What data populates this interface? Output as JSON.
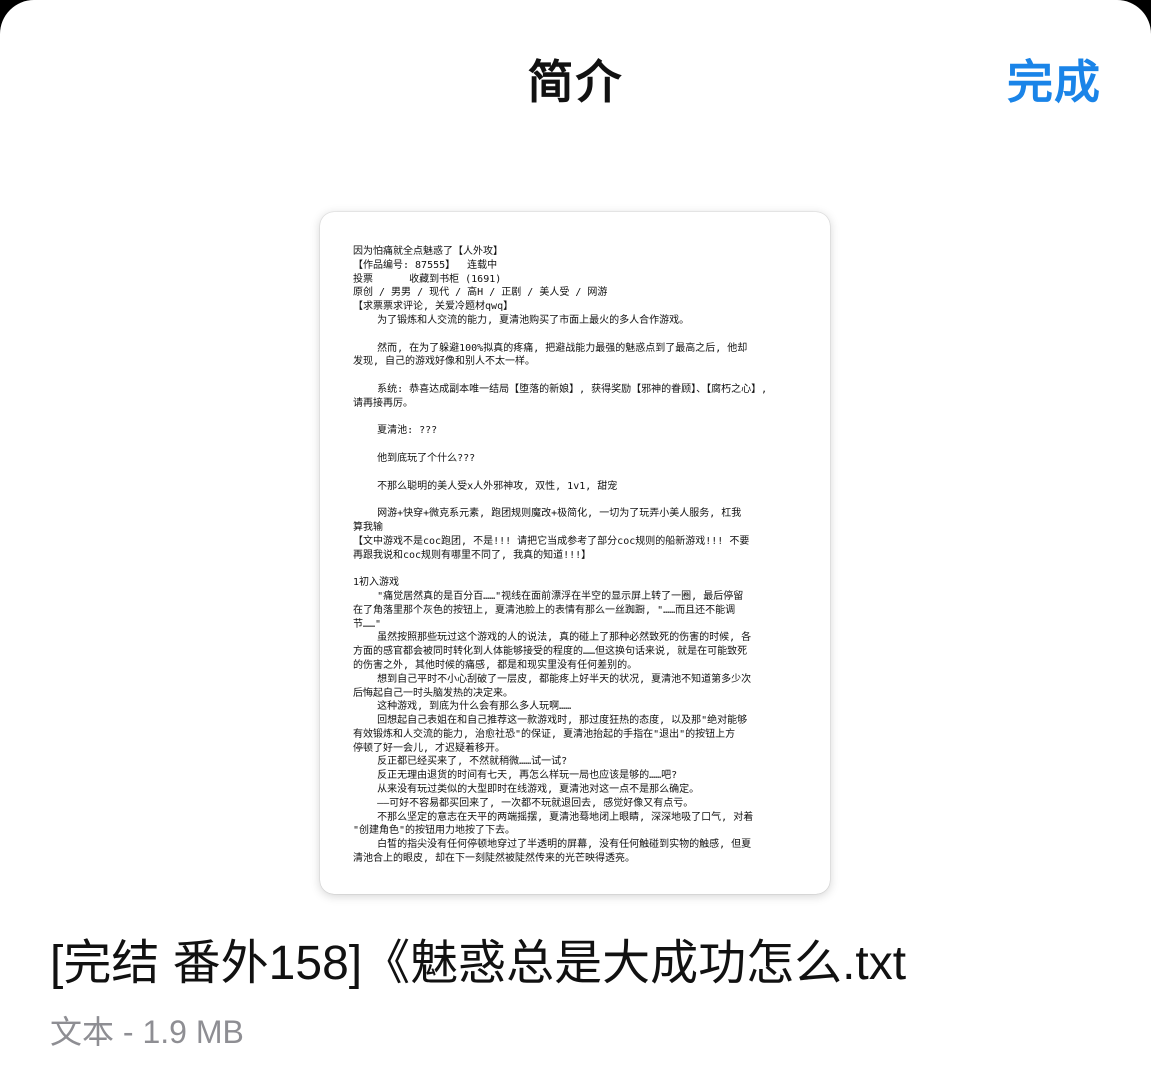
{
  "header": {
    "title": "简介",
    "done_label": "完成"
  },
  "document": {
    "lines": [
      "因为怕痛就全点魅惑了【人外攻】",
      "【作品编号: 87555】  连载中",
      "投票      收藏到书柜 (1691)",
      "原创 / 男男 / 现代 / 高H / 正剧 / 美人受 / 网游",
      "【求票票求评论, 关爱冷题材qwq】",
      "    为了锻炼和人交流的能力, 夏清池购买了市面上最火的多人合作游戏。",
      "",
      "    然而, 在为了躲避100%拟真的疼痛, 把避战能力最强的魅惑点到了最高之后, 他却",
      "发现, 自己的游戏好像和别人不太一样。",
      "",
      "    系统: 恭喜达成副本唯一结局【堕落的新娘】, 获得奖励【邪神的眷顾】、【腐朽之心】,",
      "请再接再厉。",
      "",
      "    夏清池: ???",
      "",
      "    他到底玩了个什么???",
      "",
      "    不那么聪明的美人受x人外邪神攻, 双性, 1v1, 甜宠",
      "",
      "    网游+快穿+微克系元素, 跑团规则魔改+极简化, 一切为了玩弄小美人服务, 杠我",
      "算我输",
      "【文中游戏不是coc跑团, 不是!!! 请把它当成参考了部分coc规则的船新游戏!!! 不要",
      "再跟我说和coc规则有哪里不同了, 我真的知道!!!】",
      "",
      "1初入游戏",
      "    \"痛觉居然真的是百分百……\"视线在面前漂浮在半空的显示屏上转了一圈, 最后停留",
      "在了角落里那个灰色的按钮上, 夏清池脸上的表情有那么一丝踟蹰, \"……而且还不能调",
      "节……\"",
      "    虽然按照那些玩过这个游戏的人的说法, 真的碰上了那种必然致死的伤害的时候, 各",
      "方面的感官都会被同时转化到人体能够接受的程度的……但这换句话来说, 就是在可能致死",
      "的伤害之外, 其他时候的痛感, 都是和现实里没有任何差别的。",
      "    想到自己平时不小心刮破了一层皮, 都能疼上好半天的状况, 夏清池不知道第多少次",
      "后悔起自己一时头脑发热的决定来。",
      "    这种游戏, 到底为什么会有那么多人玩啊……",
      "    回想起自己表姐在和自己推荐这一款游戏时, 那过度狂热的态度, 以及那\"绝对能够",
      "有效锻炼和人交流的能力, 治愈社恐\"的保证, 夏清池抬起的手指在\"退出\"的按钮上方",
      "停顿了好一会儿, 才迟疑着移开。",
      "    反正都已经买来了, 不然就稍微……试一试?",
      "    反正无理由退货的时间有七天, 再怎么样玩一局也应该是够的……吧?",
      "    从来没有玩过类似的大型即时在线游戏, 夏清池对这一点不是那么确定。",
      "    ——可好不容易都买回来了, 一次都不玩就退回去, 感觉好像又有点亏。",
      "    不那么坚定的意志在天平的两端摇摆, 夏清池蓦地闭上眼睛, 深深地吸了口气, 对着",
      "\"创建角色\"的按钮用力地按了下去。",
      "    白皙的指尖没有任何停顿地穿过了半透明的屏幕, 没有任何触碰到实物的触感, 但夏",
      "清池合上的眼皮, 却在下一刻陡然被陡然传来的光芒映得透亮。"
    ]
  },
  "file": {
    "name": "[完结 番外158]《魅惑总是大成功怎么.txt",
    "meta": "文本 - 1.9 MB"
  },
  "colors": {
    "accent": "#1a84e8",
    "secondary_text": "#8e8e93",
    "backdrop": "#000000"
  }
}
